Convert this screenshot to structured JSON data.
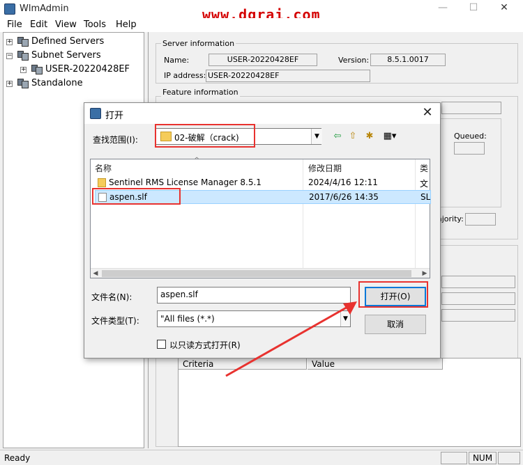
{
  "app": {
    "title": "WlmAdmin",
    "watermark": "www.dgrai.com",
    "controls": {
      "minimize": "—",
      "maximize": "☐",
      "close": "✕"
    }
  },
  "menu": [
    "File",
    "Edit",
    "View",
    "Tools",
    "Help"
  ],
  "tree": {
    "items": [
      {
        "label": "Defined Servers",
        "expander": "+"
      },
      {
        "label": "Subnet Servers",
        "expander": "−"
      },
      {
        "label": "USER-20220428EF",
        "expander": "+"
      },
      {
        "label": "Standalone",
        "expander": "+"
      }
    ]
  },
  "server_info": {
    "legend": "Server information",
    "name_label": "Name:",
    "name_value": "USER-20220428EF",
    "version_label": "Version:",
    "version_value": "8.5.1.0017",
    "ip_label": "IP address:",
    "ip_value": "USER-20220428EF"
  },
  "feature_info": {
    "legend": "Feature information",
    "queued_label": "Queued:",
    "majority_label": "ajority:"
  },
  "table": {
    "columns": [
      "Criteria",
      "Value"
    ]
  },
  "status": {
    "text": "Ready",
    "num": "NUM"
  },
  "dialog": {
    "title": "打开",
    "close": "✕",
    "lookin_label": "查找范围(I):",
    "lookin_value": "02-破解（crack)",
    "toolbar_icons": {
      "back": "⇦",
      "up": "⇧",
      "new_folder": "✱",
      "view": "▦▾"
    },
    "columns": {
      "name": "名称",
      "date": "修改日期",
      "type": "类"
    },
    "files": [
      {
        "name": "Sentinel RMS License Manager 8.5.1",
        "date": "2024/4/16 12:11",
        "type": "文",
        "kind": "folder"
      },
      {
        "name": "aspen.slf",
        "date": "2017/6/26 14:35",
        "type": "SL",
        "kind": "file"
      }
    ],
    "filename_label": "文件名(N):",
    "filename_value": "aspen.slf",
    "filetype_label": "文件类型(T):",
    "filetype_value": "\"All files (*.*)",
    "open_label": "打开(O)",
    "cancel_label": "取消",
    "readonly_label": "以只读方式打开(R)"
  },
  "colors": {
    "annotation": "#e8322f",
    "selection": "#cce8ff",
    "accent": "#0078d7"
  }
}
